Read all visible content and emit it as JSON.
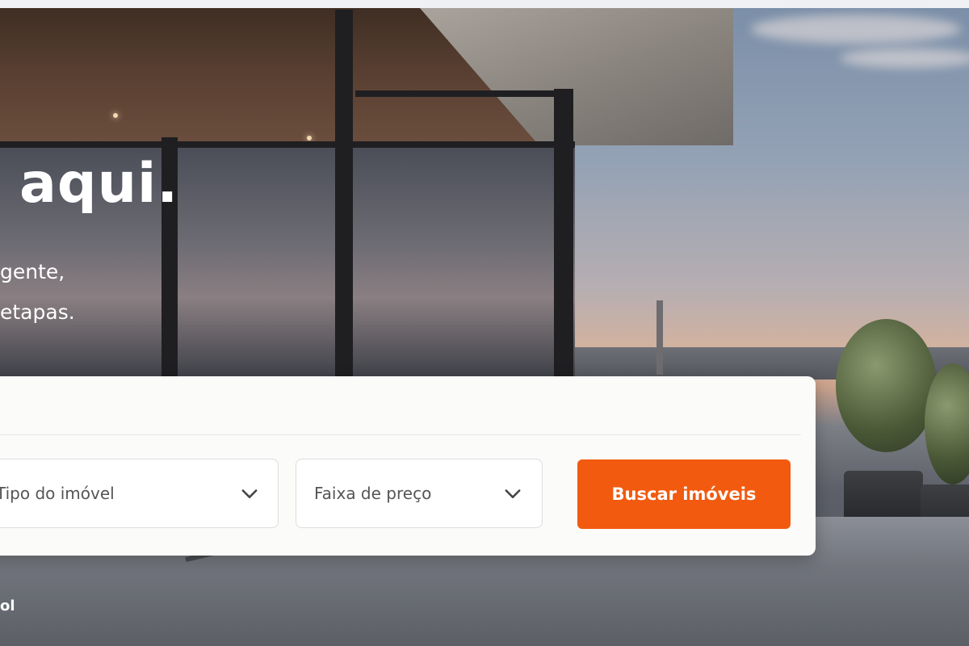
{
  "hero": {
    "title": "aqui.",
    "subtitle_lines": [
      "gente,",
      "etapas."
    ]
  },
  "search": {
    "property_type": {
      "label": "Tipo do imóvel"
    },
    "price_range": {
      "label": "Faixa de preço"
    },
    "submit_label": "Buscar imóveis"
  },
  "footer_glyph": "ol",
  "colors": {
    "accent": "#f25a0f",
    "card_bg": "#fbfbfa"
  },
  "icons": {
    "dropdown": "chevron-down-icon"
  }
}
